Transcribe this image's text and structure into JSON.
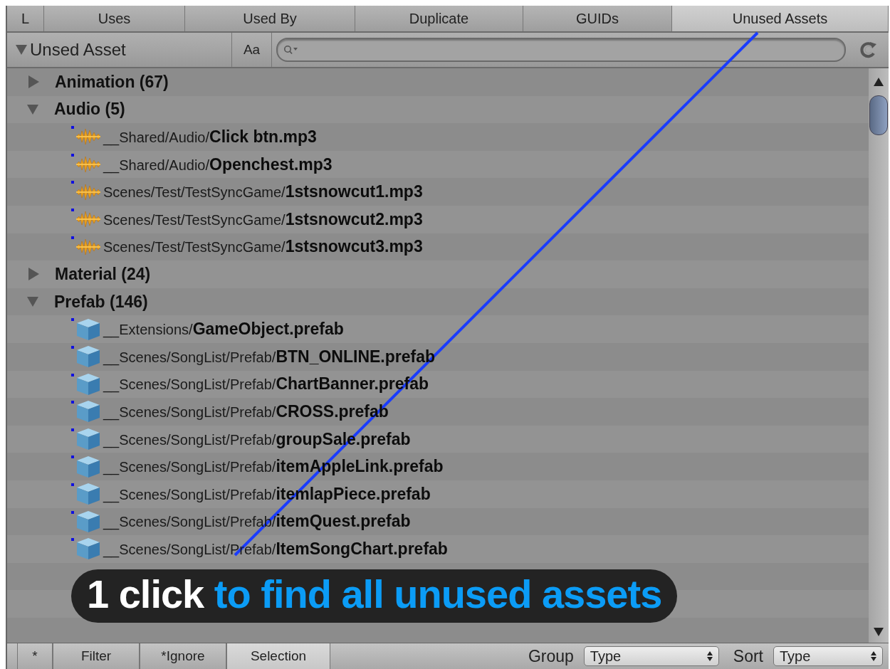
{
  "tabs": [
    {
      "label": "L",
      "selected": false
    },
    {
      "label": "Uses",
      "selected": false
    },
    {
      "label": "Used By",
      "selected": false
    },
    {
      "label": "Duplicate",
      "selected": false
    },
    {
      "label": "GUIDs",
      "selected": false
    },
    {
      "label": "Unused Assets",
      "selected": true
    }
  ],
  "toolbar": {
    "dropdown": "Unsed Asset",
    "case_button": "Aa"
  },
  "tree": [
    {
      "label": "Animation (67)",
      "expanded": false
    },
    {
      "label": "Audio (5)",
      "expanded": true,
      "children": [
        {
          "kind": "audio",
          "text": "__Shared/Audio/**Click btn.mp3**"
        },
        {
          "kind": "audio",
          "text": "__Shared/Audio/**Openchest.mp3**"
        },
        {
          "kind": "audio",
          "text": "Scenes/Test/TestSyncGame/**1stsnowcut1.mp3**"
        },
        {
          "kind": "audio",
          "text": "Scenes/Test/TestSyncGame/**1stsnowcut2.mp3**"
        },
        {
          "kind": "audio",
          "text": "Scenes/Test/TestSyncGame/**1stsnowcut3.mp3**"
        }
      ]
    },
    {
      "label": "Material (24)",
      "expanded": false
    },
    {
      "label": "Prefab (146)",
      "expanded": true,
      "children": [
        {
          "kind": "prefab",
          "text": "__Extensions/**GameObject.prefab**"
        },
        {
          "kind": "prefab",
          "text": "__Scenes/SongList/Prefab/**BTN_ONLINE.prefab**"
        },
        {
          "kind": "prefab",
          "text": "__Scenes/SongList/Prefab/**ChartBanner.prefab**"
        },
        {
          "kind": "prefab",
          "text": "__Scenes/SongList/Prefab/**CROSS.prefab**"
        },
        {
          "kind": "prefab",
          "text": "__Scenes/SongList/Prefab/**groupSale.prefab**"
        },
        {
          "kind": "prefab",
          "text": "__Scenes/SongList/Prefab/**itemAppleLink.prefab**"
        },
        {
          "kind": "prefab",
          "text": "__Scenes/SongList/Prefab/**itemlapPiece.prefab**"
        },
        {
          "kind": "prefab",
          "text": "__Scenes/SongList/Prefab/**itemQuest.prefab**"
        },
        {
          "kind": "prefab",
          "text": "__Scenes/SongList/Prefab/**ItemSongChart.prefab**"
        }
      ]
    }
  ],
  "bottom_bar": {
    "filters": [
      {
        "label": "*",
        "selected": false
      },
      {
        "label": "Filter",
        "selected": false
      },
      {
        "label": "*Ignore",
        "selected": false
      },
      {
        "label": "Selection",
        "selected": true
      }
    ],
    "group": {
      "label": "Group",
      "value": "Type"
    },
    "sort": {
      "label": "Sort",
      "value": "Type"
    }
  },
  "caption": {
    "lead": "1 click",
    "rest": "to find all unused assets"
  }
}
